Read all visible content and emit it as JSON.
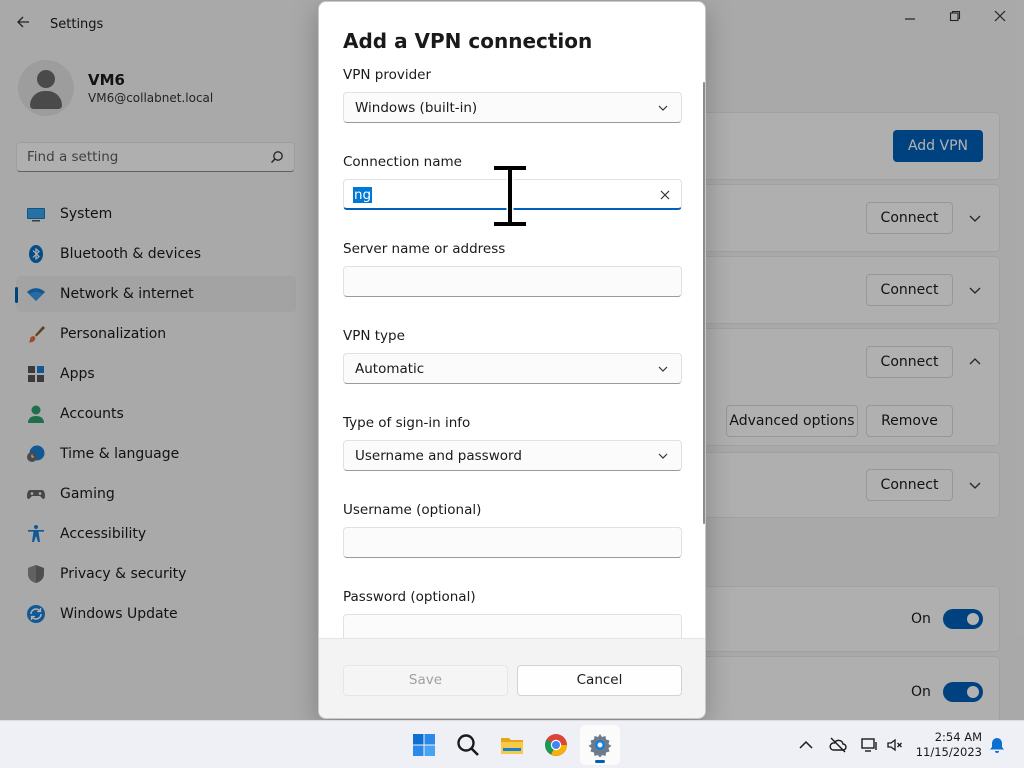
{
  "window": {
    "title": "Settings",
    "back_icon": "back-arrow-icon",
    "minimize_glyph": "—",
    "maximize_glyph": "❐",
    "close_glyph": "✕"
  },
  "profile": {
    "name": "VM6",
    "email": "VM6@collabnet.local"
  },
  "search": {
    "placeholder": "Find a setting"
  },
  "sidebar": {
    "items": [
      {
        "label": "System",
        "icon": "system-icon"
      },
      {
        "label": "Bluetooth & devices",
        "icon": "bluetooth-icon"
      },
      {
        "label": "Network & internet",
        "icon": "wifi-icon",
        "active": true
      },
      {
        "label": "Personalization",
        "icon": "brush-icon"
      },
      {
        "label": "Apps",
        "icon": "apps-icon"
      },
      {
        "label": "Accounts",
        "icon": "person-icon"
      },
      {
        "label": "Time & language",
        "icon": "clock-globe-icon"
      },
      {
        "label": "Gaming",
        "icon": "controller-icon"
      },
      {
        "label": "Accessibility",
        "icon": "accessibility-icon"
      },
      {
        "label": "Privacy & security",
        "icon": "shield-icon"
      },
      {
        "label": "Windows Update",
        "icon": "update-icon"
      }
    ]
  },
  "main": {
    "add_vpn_label": "Add VPN",
    "connect_label": "Connect",
    "advanced_options_label": "Advanced options",
    "remove_label": "Remove",
    "toggle_on_label": "On"
  },
  "dialog": {
    "title": "Add a VPN connection",
    "vpn_provider_label": "VPN provider",
    "vpn_provider_value": "Windows (built-in)",
    "connection_name_label": "Connection name",
    "connection_name_value": "ng",
    "server_label": "Server name or address",
    "server_value": "",
    "vpn_type_label": "VPN type",
    "vpn_type_value": "Automatic",
    "signin_label": "Type of sign-in info",
    "signin_value": "Username and password",
    "username_label": "Username (optional)",
    "username_value": "",
    "password_label": "Password (optional)",
    "save_label": "Save",
    "cancel_label": "Cancel"
  },
  "taskbar": {
    "apps": [
      "start-icon",
      "search-icon",
      "file-explorer-icon",
      "chrome-icon",
      "settings-icon"
    ],
    "time": "2:54 AM",
    "date": "11/15/2023"
  },
  "colors": {
    "accent": "#005fb8",
    "selection": "#0078d4"
  }
}
